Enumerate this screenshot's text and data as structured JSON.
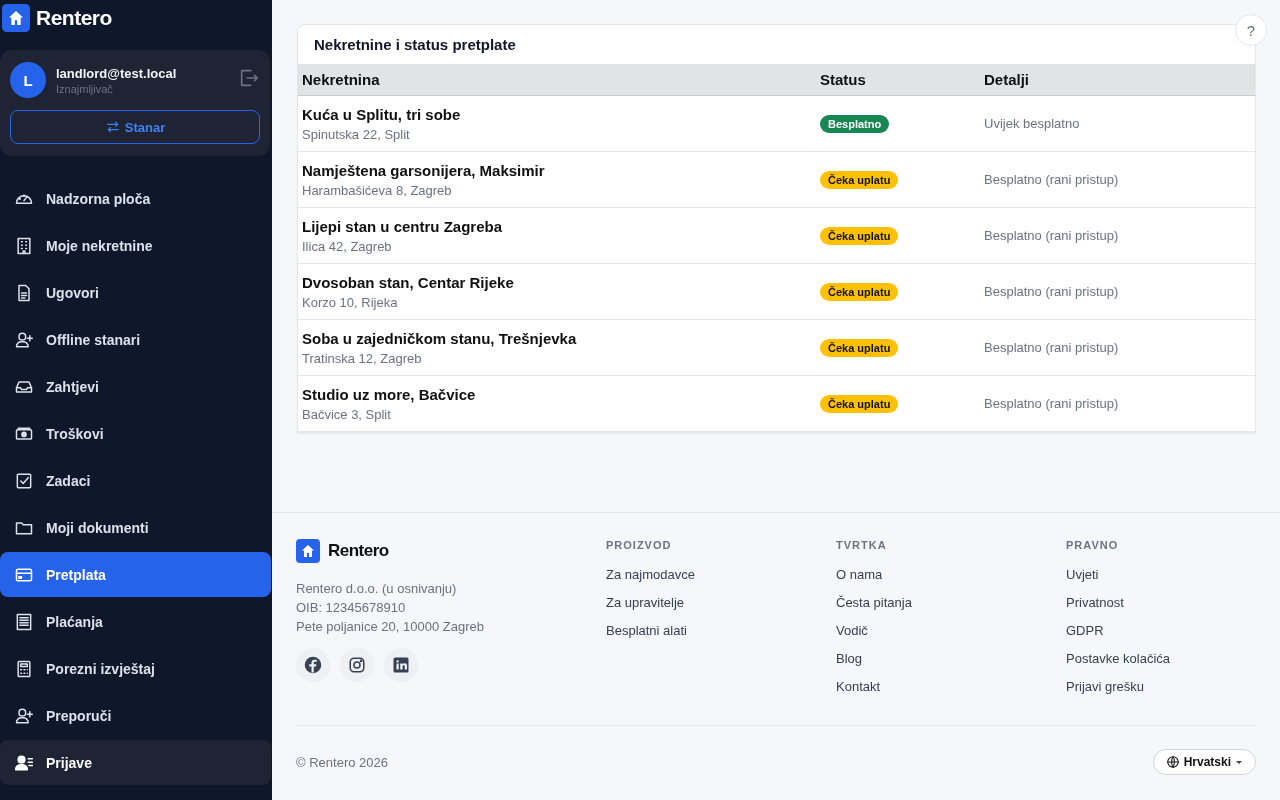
{
  "sidebar": {
    "brand": "Rentero",
    "user": {
      "avatar": "L",
      "email": "landlord@test.local",
      "role": "Iznajmljivač",
      "switch_button": "Stanar"
    },
    "items": [
      {
        "label": "Nadzorna ploča",
        "selected": false,
        "hovered": false
      },
      {
        "label": "Moje nekretnine",
        "selected": false,
        "hovered": false
      },
      {
        "label": "Ugovori",
        "selected": false,
        "hovered": false
      },
      {
        "label": "Offline stanari",
        "selected": false,
        "hovered": false
      },
      {
        "label": "Zahtjevi",
        "selected": false,
        "hovered": false
      },
      {
        "label": "Troškovi",
        "selected": false,
        "hovered": false
      },
      {
        "label": "Zadaci",
        "selected": false,
        "hovered": false
      },
      {
        "label": "Moji dokumenti",
        "selected": false,
        "hovered": false
      },
      {
        "label": "Pretplata",
        "selected": true,
        "hovered": false
      },
      {
        "label": "Plaćanja",
        "selected": false,
        "hovered": false
      },
      {
        "label": "Porezni izvještaj",
        "selected": false,
        "hovered": false
      },
      {
        "label": "Preporuči",
        "selected": false,
        "hovered": false
      },
      {
        "label": "Prijave",
        "selected": false,
        "hovered": true
      }
    ]
  },
  "help_button": "?",
  "card": {
    "title": "Nekretnine i status pretplate",
    "columns": [
      "Nekretnina",
      "Status",
      "Detalji"
    ],
    "rows": [
      {
        "name": "Kuća u Splitu, tri sobe",
        "address": "Spinutska 22, Split",
        "status": {
          "label": "Besplatno",
          "color": "#198754"
        },
        "details": "Uvijek besplatno"
      },
      {
        "name": "Namještena garsonijera, Maksimir",
        "address": "Harambašićeva 8, Zagreb",
        "status": {
          "label": "Čeka uplatu",
          "color": "#ffc107"
        },
        "details": "Besplatno (rani pristup)"
      },
      {
        "name": "Lijepi stan u centru Zagreba",
        "address": "Ilica 42, Zagreb",
        "status": {
          "label": "Čeka uplatu",
          "color": "#ffc107"
        },
        "details": "Besplatno (rani pristup)"
      },
      {
        "name": "Dvosoban stan, Centar Rijeke",
        "address": "Korzo 10, Rijeka",
        "status": {
          "label": "Čeka uplatu",
          "color": "#ffc107"
        },
        "details": "Besplatno (rani pristup)"
      },
      {
        "name": "Soba u zajedničkom stanu, Trešnjevka",
        "address": "Tratinska 12, Zagreb",
        "status": {
          "label": "Čeka uplatu",
          "color": "#ffc107"
        },
        "details": "Besplatno (rani pristup)"
      },
      {
        "name": "Studio uz more, Bačvice",
        "address": "Bačvice 3, Split",
        "status": {
          "label": "Čeka uplatu",
          "color": "#ffc107"
        },
        "details": "Besplatno (rani pristup)"
      }
    ]
  },
  "footer": {
    "brand": "Rentero",
    "company_lines": [
      "Rentero d.o.o. (u osnivanju)",
      "OIB: 12345678910",
      "Pete poljanice 20, 10000 Zagreb"
    ],
    "columns": [
      {
        "heading": "PROIZVOD",
        "links": [
          "Za najmodavce",
          "Za upravitelje",
          "Besplatni alati"
        ]
      },
      {
        "heading": "TVRTKA",
        "links": [
          "O nama",
          "Česta pitanja",
          "Vodič",
          "Blog",
          "Kontakt"
        ]
      },
      {
        "heading": "PRAVNO",
        "links": [
          "Uvjeti",
          "Privatnost",
          "GDPR",
          "Postavke kolačića",
          "Prijavi grešku"
        ]
      }
    ],
    "copyright": "© Rentero 2026",
    "language": "Hrvatski"
  }
}
